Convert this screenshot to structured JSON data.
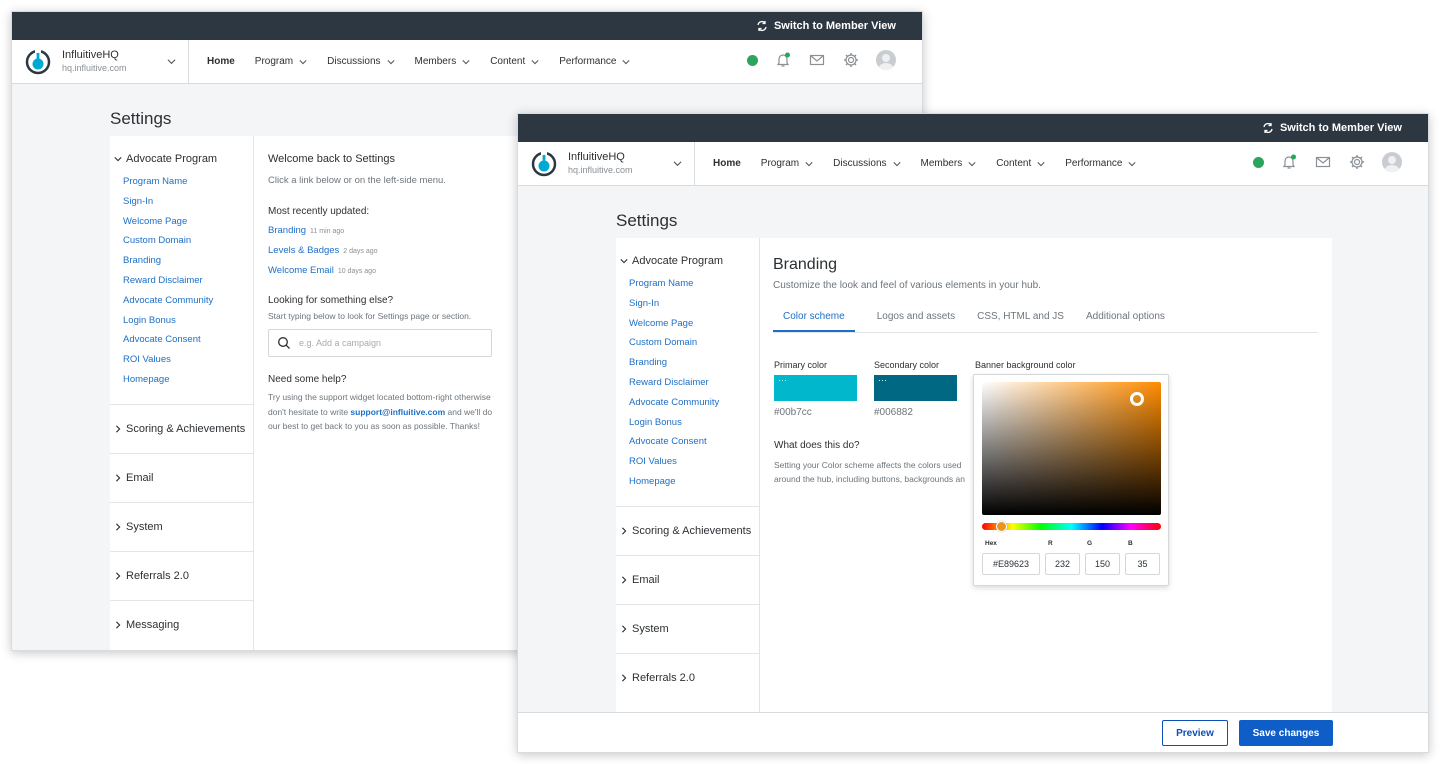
{
  "topbar": {
    "switch_label": "Switch to Member View"
  },
  "brand": {
    "name": "InfluitiveHQ",
    "domain": "hq.influitive.com"
  },
  "nav": [
    "Home",
    "Program",
    "Discussions",
    "Members",
    "Content",
    "Performance"
  ],
  "settings_title": "Settings",
  "sidebar": {
    "group": "Advocate Program",
    "items": [
      "Program Name",
      "Sign-In",
      "Welcome Page",
      "Custom Domain",
      "Branding",
      "Reward Disclaimer",
      "Advocate Community",
      "Login Bonus",
      "Advocate Consent",
      "ROI Values",
      "Homepage"
    ],
    "sections": [
      "Scoring & Achievements",
      "Email",
      "System",
      "Referrals 2.0",
      "Messaging"
    ]
  },
  "welcome": {
    "heading": "Welcome back to Settings",
    "sub": "Click a link below or on the left-side menu.",
    "recent_heading": "Most recently updated:",
    "recent": [
      {
        "label": "Branding",
        "ago": "11 min ago"
      },
      {
        "label": "Levels & Badges",
        "ago": "2 days ago"
      },
      {
        "label": "Welcome Email",
        "ago": "10 days ago"
      }
    ],
    "looking_heading": "Looking for something else?",
    "looking_sub": "Start typing below to look for Settings page or section.",
    "search_placeholder": "e.g. Add a campaign",
    "help_heading": "Need some help?",
    "help_line1": "Try using the support widget located bottom-right otherwise",
    "help_line2a": "don't hesitate to write ",
    "help_email": "support@influitive.com",
    "help_line2b": " and we'll do",
    "help_line3": "our best to get back to you as soon as possible. Thanks!"
  },
  "branding": {
    "title": "Branding",
    "subtitle": "Customize the look and feel of various elements in your hub.",
    "tabs": [
      "Color scheme",
      "Logos and assets",
      "CSS, HTML and JS",
      "Additional options"
    ],
    "primary_label": "Primary color",
    "primary_hex": "#00b7cc",
    "secondary_label": "Secondary color",
    "secondary_hex": "#006882",
    "banner_label": "Banner background color",
    "what_heading": "What does this do?",
    "what_line1": "Setting your Color scheme affects the colors used",
    "what_line2": "around the hub, including buttons, backgrounds an"
  },
  "picker": {
    "hex_label": "Hex",
    "r_label": "R",
    "g_label": "G",
    "b_label": "B",
    "hex": "#E89623",
    "r": "232",
    "g": "150",
    "b": "35"
  },
  "footer": {
    "preview": "Preview",
    "save": "Save changes"
  },
  "colors": {
    "primary": "#00b7cc",
    "secondary": "#006882",
    "accent": "#1d6fc7",
    "topbar": "#2d3741",
    "status": "#2aa65c"
  }
}
